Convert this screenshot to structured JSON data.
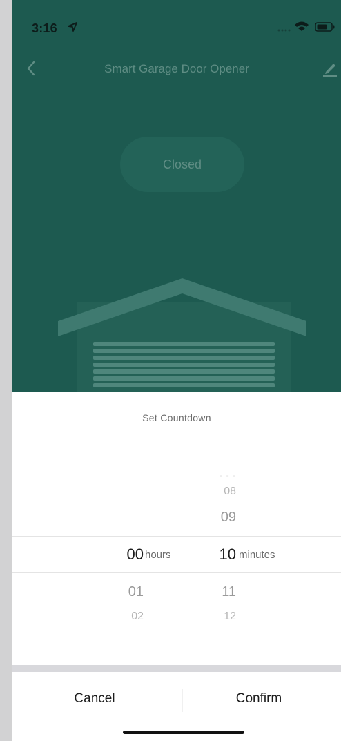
{
  "status_bar": {
    "time": "3:16",
    "icons": [
      "location-arrow-icon",
      "signal-icon",
      "wifi-icon",
      "battery-icon"
    ]
  },
  "nav": {
    "title": "Smart Garage Door Opener",
    "icons": [
      "back-chevron-icon",
      "edit-pencil-icon"
    ]
  },
  "device": {
    "status": "Closed"
  },
  "sheet": {
    "title": "Set Countdown",
    "hours": {
      "selected": "00",
      "unit": "hours",
      "below": [
        "01",
        "02"
      ]
    },
    "minutes": {
      "above": [
        "08",
        "09"
      ],
      "selected": "10",
      "unit": "minutes",
      "below": [
        "11",
        "12"
      ]
    },
    "cancel_label": "Cancel",
    "confirm_label": "Confirm"
  },
  "colors": {
    "header_teal_dimmed": "#1d5a50",
    "sheet_background": "#ffffff",
    "text_dark": "#1d1d1d",
    "text_muted": "#9a9a9a"
  }
}
